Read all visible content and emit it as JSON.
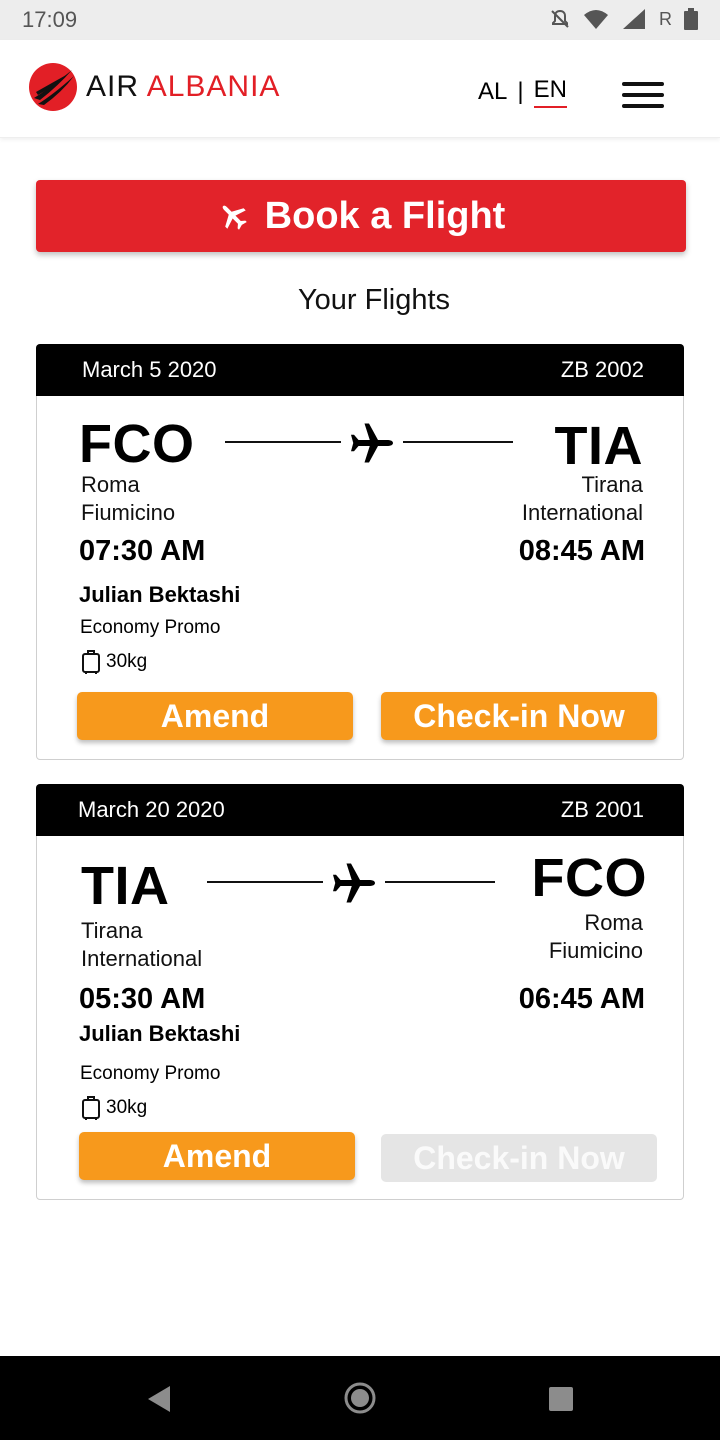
{
  "status_bar": {
    "time": "17:09",
    "carrier_indicator": "R",
    "icons": [
      "bell-off-icon",
      "wifi-icon",
      "signal-icon",
      "battery-icon"
    ]
  },
  "header": {
    "logo": {
      "word_1": "AIR",
      "word_2": "ALBANIA"
    },
    "lang": {
      "al": "AL",
      "separator": "|",
      "en": "EN",
      "active": "EN"
    },
    "menu_icon": "hamburger-menu-icon"
  },
  "book_button": {
    "label": "Book a Flight",
    "icon": "airplane-icon"
  },
  "flights_title": "Your Flights",
  "flights": [
    {
      "date": "March 5 2020",
      "flight_number": "ZB 2002",
      "origin": {
        "code": "FCO",
        "name_line1": "Roma",
        "name_line2": "Fiumicino",
        "time": "07:30 AM"
      },
      "destination": {
        "code": "TIA",
        "name_line1": "Tirana",
        "name_line2": "International",
        "time": "08:45 AM"
      },
      "passenger": "Julian Bektashi",
      "fare_class": "Economy Promo",
      "baggage": "30kg",
      "amend_label": "Amend",
      "checkin_label": "Check-in Now",
      "checkin_enabled": true
    },
    {
      "date": "March 20 2020",
      "flight_number": "ZB 2001",
      "origin": {
        "code": "TIA",
        "name_line1": "Tirana",
        "name_line2": "International",
        "time": "05:30 AM"
      },
      "destination": {
        "code": "FCO",
        "name_line1": "Roma",
        "name_line2": "Fiumicino",
        "time": "06:45 AM"
      },
      "passenger": "Julian Bektashi",
      "fare_class": "Economy Promo",
      "baggage": "30kg",
      "amend_label": "Amend",
      "checkin_label": "Check-in Now",
      "checkin_enabled": false
    }
  ],
  "colors": {
    "brand_red": "#e2232a",
    "action_orange": "#f7991c",
    "disabled_gray": "#e5e5e5"
  },
  "nav_bar": {
    "icons": [
      "back-icon",
      "home-icon",
      "recent-apps-icon"
    ]
  }
}
